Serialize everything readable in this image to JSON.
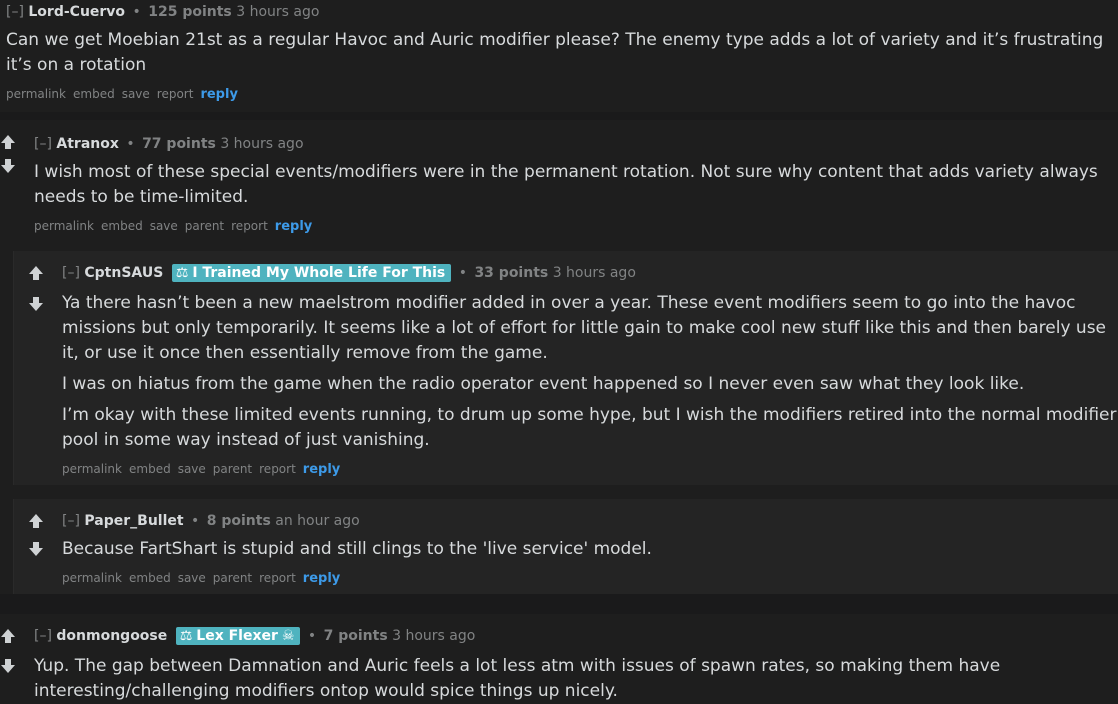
{
  "comments": [
    {
      "expand": "[–]",
      "author": "Lord-Cuervo",
      "score": "125 points",
      "time": "3 hours ago",
      "paragraphs": [
        "Can we get Moebian 21st as a regular Havoc and Auric modifier please? The enemy type adds a lot of variety and it’s frustrating it’s on a rotation"
      ],
      "buttons": {
        "permalink": "permalink",
        "embed": "embed",
        "save": "save",
        "report": "report",
        "reply": "reply"
      }
    },
    {
      "expand": "[–]",
      "author": "Atranox",
      "score": "77 points",
      "time": "3 hours ago",
      "paragraphs": [
        "I wish most of these special events/modifiers were in the permanent rotation. Not sure why content that adds variety always needs to be time-limited."
      ],
      "buttons": {
        "permalink": "permalink",
        "embed": "embed",
        "save": "save",
        "parent": "parent",
        "report": "report",
        "reply": "reply"
      }
    },
    {
      "expand": "[–]",
      "author": "CptnSAUS",
      "flair": {
        "text": "I Trained My Whole Life For This"
      },
      "score": "33 points",
      "time": "3 hours ago",
      "paragraphs": [
        "Ya there hasn’t been a new maelstrom modifier added in over a year. These event modifiers seem to go into the havoc missions but only temporarily. It seems like a lot of effort for little gain to make cool new stuff like this and then barely use it, or use it once then essentially remove from the game.",
        "I was on hiatus from the game when the radio operator event happened so I never even saw what they look like.",
        "I’m okay with these limited events running, to drum up some hype, but I wish the modifiers retired into the normal modifier pool in some way instead of just vanishing."
      ],
      "buttons": {
        "permalink": "permalink",
        "embed": "embed",
        "save": "save",
        "parent": "parent",
        "report": "report",
        "reply": "reply"
      }
    },
    {
      "expand": "[–]",
      "author": "Paper_Bullet",
      "score": "8 points",
      "time": "an hour ago",
      "paragraphs": [
        "Because FartShart is stupid and still clings to the 'live service' model."
      ],
      "buttons": {
        "permalink": "permalink",
        "embed": "embed",
        "save": "save",
        "parent": "parent",
        "report": "report",
        "reply": "reply"
      }
    },
    {
      "expand": "[–]",
      "author": "donmongoose",
      "flair": {
        "text": "Lex Flexer"
      },
      "score": "7 points",
      "time": "3 hours ago",
      "paragraphs": [
        "Yup. The gap between Damnation and Auric feels a lot less atm with issues of spawn rates, so making them have interesting/challenging modifiers ontop would spice things up nicely."
      ]
    }
  ],
  "icons": {
    "upvote": "arrow-up-icon",
    "downvote": "arrow-down-icon",
    "flair": "scales-icon",
    "flair_skull": "skull-icon"
  },
  "colors": {
    "background": "#1a1a1b",
    "comment_bg": "#1e1e1e",
    "nested_bg": "#242424",
    "flair_bg": "#4fb3bf",
    "reply_link": "#3d9ae8"
  }
}
